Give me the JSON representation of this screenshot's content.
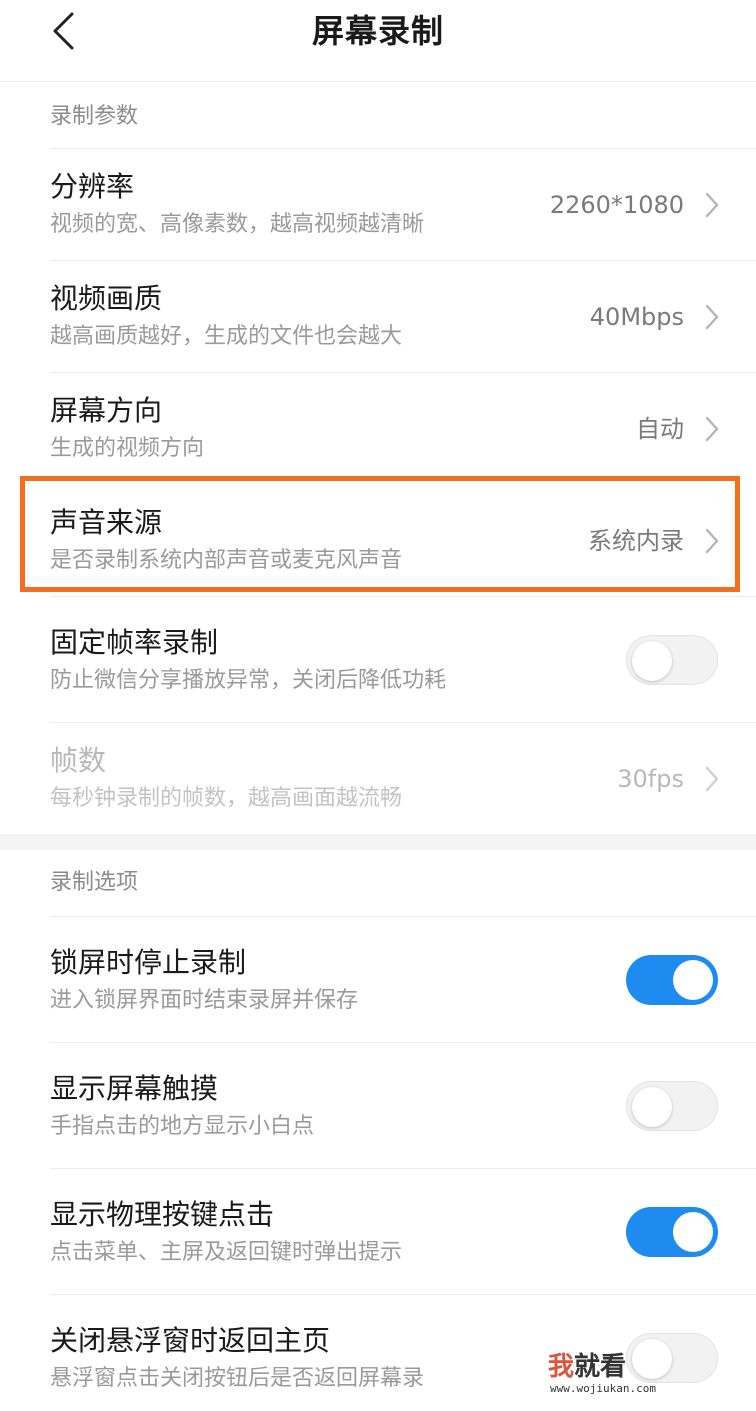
{
  "header": {
    "title": "屏幕录制",
    "back_icon": "chevron-left-icon"
  },
  "sections": {
    "params_label": "录制参数",
    "options_label": "录制选项"
  },
  "rows": {
    "resolution": {
      "title": "分辨率",
      "subtitle": "视频的宽、高像素数，越高视频越清晰",
      "value": "2260*1080"
    },
    "quality": {
      "title": "视频画质",
      "subtitle": "越高画质越好，生成的文件也会越大",
      "value": "40Mbps"
    },
    "orientation": {
      "title": "屏幕方向",
      "subtitle": "生成的视频方向",
      "value": "自动"
    },
    "audio_source": {
      "title": "声音来源",
      "subtitle": "是否录制系统内部声音或麦克风声音",
      "value": "系统内录"
    },
    "fixed_framerate": {
      "title": "固定帧率录制",
      "subtitle": "防止微信分享播放异常，关闭后降低功耗",
      "toggle": "off"
    },
    "framerate": {
      "title": "帧数",
      "subtitle": "每秒钟录制的帧数，越高画面越流畅",
      "value": "30fps",
      "state": "disabled"
    },
    "stop_on_lock": {
      "title": "锁屏时停止录制",
      "subtitle": "进入锁屏界面时结束录屏并保存",
      "toggle": "on"
    },
    "show_touches": {
      "title": "显示屏幕触摸",
      "subtitle": "手指点击的地方显示小白点",
      "toggle": "off"
    },
    "show_key_presses": {
      "title": "显示物理按键点击",
      "subtitle": "点击菜单、主屏及返回键时弹出提示",
      "toggle": "on"
    },
    "return_home": {
      "title": "关闭悬浮窗时返回主页",
      "subtitle": "悬浮窗点击关闭按钮后是否返回屏幕录",
      "toggle": "off"
    }
  },
  "highlight": {
    "target": "audio_source",
    "color": "#f46e20"
  },
  "watermark": {
    "brand_a": "我",
    "brand_b": "就看",
    "url": "www.wojiukan.com"
  },
  "colors": {
    "accent": "#1e8bf0",
    "highlight": "#f46e20",
    "text_primary": "#1a1a1a",
    "text_secondary": "#9a9a9a"
  }
}
